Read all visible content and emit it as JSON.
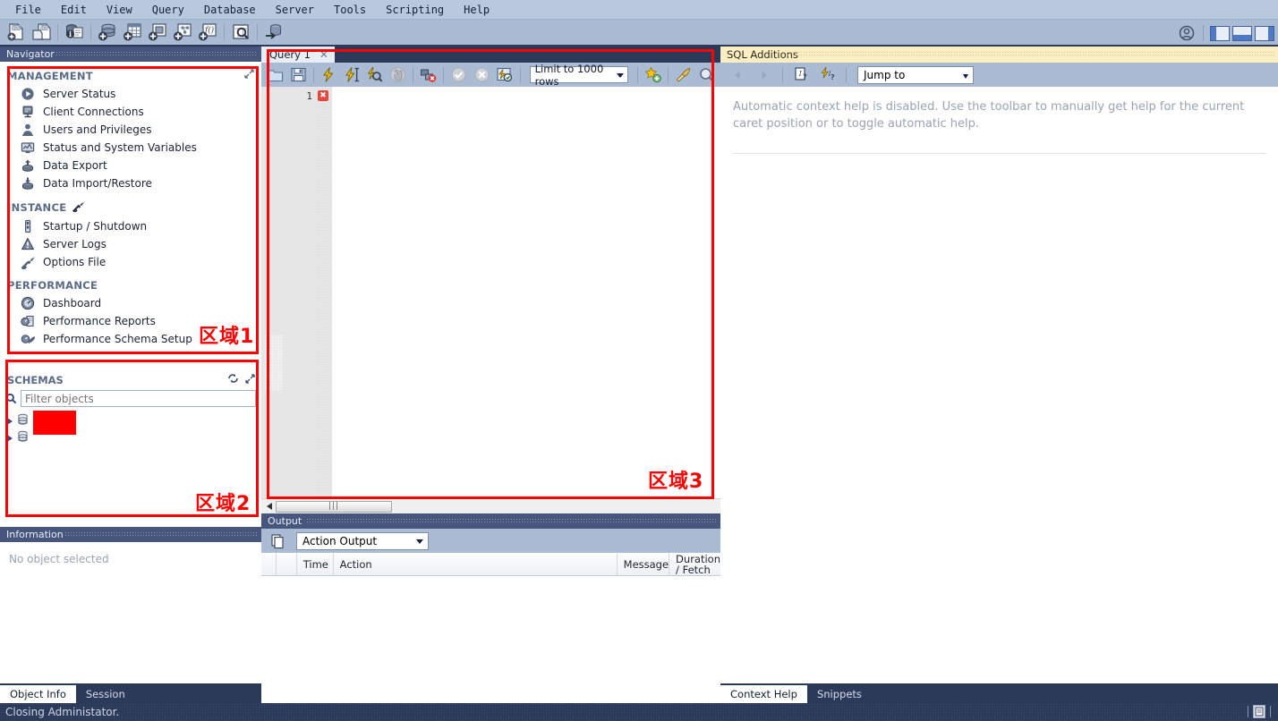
{
  "menu": {
    "items": [
      "File",
      "Edit",
      "View",
      "Query",
      "Database",
      "Server",
      "Tools",
      "Scripting",
      "Help"
    ]
  },
  "main_toolbar": {
    "icons": [
      "new-sql-tab-icon",
      "open-sql-script-icon",
      "server-info-icon",
      "create-schema-icon",
      "create-table-icon",
      "create-view-icon",
      "create-procedure-icon",
      "create-function-icon",
      "search-table-data-icon",
      "reconnect-server-icon"
    ],
    "admin_icon": "admin-icon",
    "panel_toggles": [
      "toggle-sidebar",
      "toggle-output-panel",
      "toggle-secondary-sidebar"
    ]
  },
  "navigator": {
    "title": "Navigator",
    "expand_icon": "expand-icon",
    "sections": [
      {
        "label": "MANAGEMENT",
        "items": [
          {
            "label": "Server Status",
            "icon": "play-circle-icon"
          },
          {
            "label": "Client Connections",
            "icon": "server-stack-icon"
          },
          {
            "label": "Users and Privileges",
            "icon": "user-icon"
          },
          {
            "label": "Status and System Variables",
            "icon": "monitor-chart-icon"
          },
          {
            "label": "Data Export",
            "icon": "export-up-icon"
          },
          {
            "label": "Data Import/Restore",
            "icon": "import-down-icon"
          }
        ]
      },
      {
        "label": "INSTANCE",
        "badge_icon": "wrench-plug-icon",
        "items": [
          {
            "label": "Startup / Shutdown",
            "icon": "power-strip-icon"
          },
          {
            "label": "Server Logs",
            "icon": "warning-triangle-icon"
          },
          {
            "label": "Options File",
            "icon": "wrench-icon"
          }
        ]
      },
      {
        "label": "PERFORMANCE",
        "items": [
          {
            "label": "Dashboard",
            "icon": "gauge-icon"
          },
          {
            "label": "Performance Reports",
            "icon": "report-gauge-icon"
          },
          {
            "label": "Performance Schema Setup",
            "icon": "gauge-wrench-icon"
          }
        ]
      }
    ]
  },
  "schemas": {
    "title": "SCHEMAS",
    "refresh_icon": "refresh-icon",
    "expand_icon": "expand-icon",
    "search_icon": "search-icon",
    "filter_placeholder": "Filter objects",
    "filter_value": "",
    "rows": [
      {
        "icon": "database-icon",
        "label": "",
        "redacted": true
      },
      {
        "icon": "database-icon",
        "label": "",
        "redacted": false
      }
    ]
  },
  "information": {
    "title": "Information",
    "empty_text": "No object selected",
    "tabs": [
      {
        "label": "Object Info",
        "active": true
      },
      {
        "label": "Session",
        "active": false
      }
    ]
  },
  "query": {
    "tab_label": "Query 1",
    "close_icon": "close-icon",
    "toolbar_icons": [
      "open-script-icon",
      "save-script-icon",
      "execute-icon",
      "execute-current-statement-icon",
      "explain-icon",
      "stop-icon",
      "toggle-stop-on-error-icon",
      "commit-icon",
      "rollback-icon",
      "toggle-autocommit-icon"
    ],
    "limit_label": "Limit to 1000 rows",
    "after_icons": [
      "save-snippet-icon",
      "beautify-icon",
      "find-icon"
    ],
    "gutter_line": "1",
    "error_marker_icon": "error-x-icon",
    "code": "",
    "hscroll_icon": "scrollbar-thumb"
  },
  "output": {
    "title": "Output",
    "copy_icon": "copy-icon",
    "selected_view": "Action Output",
    "columns": [
      "",
      "",
      "Time",
      "Action",
      "Message",
      "Duration\n/ Fetch"
    ],
    "col_time": "Time",
    "col_action": "Action",
    "col_message": "Message",
    "col_duration_1": "Duration",
    "col_duration_2": "/ Fetch",
    "rows": []
  },
  "sql_additions": {
    "title": "SQL Additions",
    "nav_back_icon": "arrow-left-icon",
    "nav_forward_icon": "arrow-right-icon",
    "context_help_icon": "context-help-icon",
    "auto_help_icon": "auto-context-help-icon",
    "jump_to_label": "Jump to",
    "help_text": "Automatic context help is disabled. Use the toolbar to manually get help for the current caret position or to toggle automatic help.",
    "tabs": [
      {
        "label": "Context Help",
        "active": true
      },
      {
        "label": "Snippets",
        "active": false
      }
    ]
  },
  "statusbar": {
    "message": "Closing Administator.",
    "panel_icon": "panel-toggle-icon"
  },
  "annotations": [
    {
      "label": "区域1"
    },
    {
      "label": "区域2"
    },
    {
      "label": "区域3"
    }
  ],
  "colors": {
    "annotation": "#fe0000",
    "titlebar": "#46567c",
    "chrome": "#2c3a5a",
    "toolbar": "#a9bcd4",
    "sqladd_title": "#fbeec3"
  }
}
